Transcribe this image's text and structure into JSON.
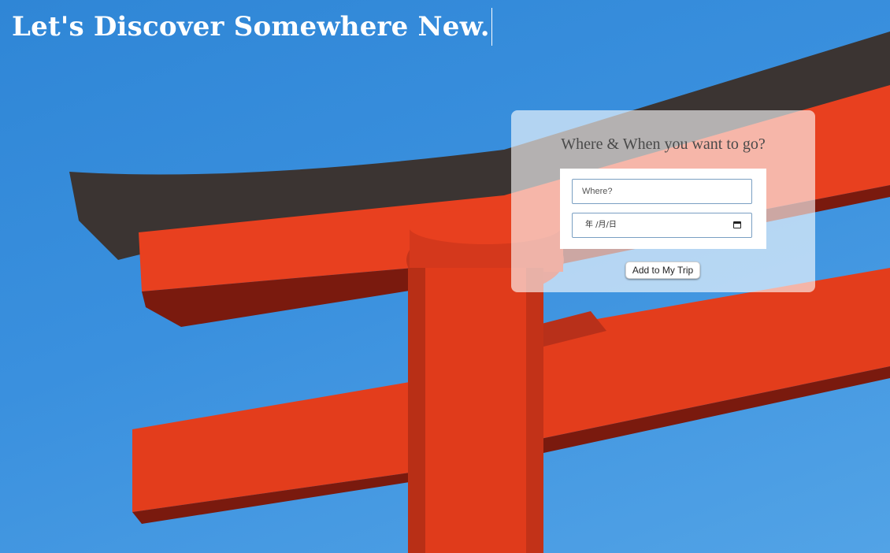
{
  "header": {
    "title": "Let's Discover Somewhere New."
  },
  "trip_form": {
    "heading": "Where & When you want to go?",
    "destination": {
      "placeholder": "Where?",
      "value": ""
    },
    "date": {
      "display": "年 /月/日",
      "value": ""
    },
    "submit_label": "Add to My Trip"
  },
  "icons": {
    "date_picker": "calendar-icon"
  },
  "colors": {
    "sky": "#3a90de",
    "gate_red": "#e8401f",
    "gate_roof": "#3b3432",
    "field_border": "#7a9fc2"
  }
}
